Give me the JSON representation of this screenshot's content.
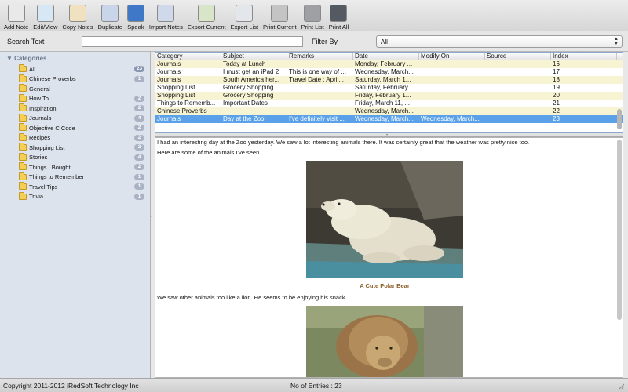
{
  "toolbar": {
    "buttons": [
      {
        "label": "Add Note",
        "icon": "add-note-icon",
        "color": "#e9e9e9"
      },
      {
        "label": "Edit/View",
        "icon": "edit-view-icon",
        "color": "#d7e7f3"
      },
      {
        "label": "Copy Notes",
        "icon": "copy-notes-icon",
        "color": "#f0e2c0"
      },
      {
        "label": "Duplicate",
        "icon": "duplicate-icon",
        "color": "#c9d6ea"
      },
      {
        "label": "Speak",
        "icon": "speak-icon",
        "color": "#3f78c6"
      },
      {
        "label": "Import Notes",
        "icon": "import-notes-icon",
        "color": "#cfd9e9"
      },
      {
        "label": "Export Current",
        "icon": "export-current-icon",
        "color": "#d8e5c8"
      },
      {
        "label": "Export List",
        "icon": "export-list-icon",
        "color": "#e3e7ec"
      },
      {
        "label": "Print Current",
        "icon": "printer-icon",
        "color": "#c4c4c4"
      },
      {
        "label": "Print List",
        "icon": "print-list-icon",
        "color": "#9ea0a4"
      },
      {
        "label": "Print All",
        "icon": "print-all-icon",
        "color": "#555a62"
      }
    ]
  },
  "search": {
    "label": "Search Text",
    "value": ""
  },
  "filter": {
    "label": "Filter By",
    "selected": "All"
  },
  "sidebar": {
    "header": "Categories",
    "items": [
      {
        "label": "All",
        "count": "23",
        "highlight": true
      },
      {
        "label": "Chinese Proverbs",
        "count": "1"
      },
      {
        "label": "General",
        "count": ""
      },
      {
        "label": "How To",
        "count": "2"
      },
      {
        "label": "Inspiration",
        "count": "2"
      },
      {
        "label": "Journals",
        "count": "4"
      },
      {
        "label": "Objective C Code",
        "count": "2"
      },
      {
        "label": "Recipes",
        "count": "2"
      },
      {
        "label": "Shopping List",
        "count": "2"
      },
      {
        "label": "Stories",
        "count": "4"
      },
      {
        "label": "Things I Bought",
        "count": "2"
      },
      {
        "label": "Things to Remember",
        "count": "1"
      },
      {
        "label": "Travel Tips",
        "count": "1"
      },
      {
        "label": "Trivia",
        "count": "1"
      }
    ]
  },
  "table": {
    "columns": [
      "Category",
      "Subject",
      "Remarks",
      "Date",
      "Modify On",
      "Source",
      "Index"
    ],
    "rows": [
      {
        "cells": [
          "Journals",
          "Today at Lunch",
          "",
          "Monday, February ...",
          "",
          "",
          "16"
        ]
      },
      {
        "cells": [
          "Journals",
          "I must get an iPad 2",
          "This is one way of ...",
          "Wednesday, March...",
          "",
          "",
          "17"
        ]
      },
      {
        "cells": [
          "Journals",
          "South America her...",
          "Travel Date : April...",
          "Saturday, March 1...",
          "",
          "",
          "18"
        ]
      },
      {
        "cells": [
          "Shopping List",
          "Grocery Shopping",
          "",
          "Saturday, February...",
          "",
          "",
          "19"
        ]
      },
      {
        "cells": [
          "Shopping List",
          "Grocery Shopping",
          "",
          "Friday, February 1...",
          "",
          "",
          "20"
        ]
      },
      {
        "cells": [
          "Things to Rememb...",
          "Important Dates",
          "",
          "Friday, March 11, ...",
          "",
          "",
          "21"
        ]
      },
      {
        "cells": [
          "Chinese Proverbs",
          "",
          "",
          "Wednesday, March...",
          "",
          "",
          "22"
        ]
      },
      {
        "cells": [
          "Journals",
          "Day at the Zoo",
          "I've definitely visit ...",
          "Wednesday, March...",
          "Wednesday, March...",
          "",
          "23"
        ],
        "selected": true
      }
    ]
  },
  "note": {
    "paragraph1": "I had an interesting day at the Zoo yesterday. We saw a lot interesting animals there. It was certainly great that the weather was pretty nice too.",
    "paragraph2": "Here are some of the animals I've seen",
    "caption1": "A Cute Polar Bear",
    "paragraph3": "We saw other animals too like a lion. He seems to be enjoying his snack."
  },
  "status": {
    "copyright": "Copyright 2011-2012 iRedSoft Technology Inc",
    "entries": "No of Entries : 23"
  }
}
